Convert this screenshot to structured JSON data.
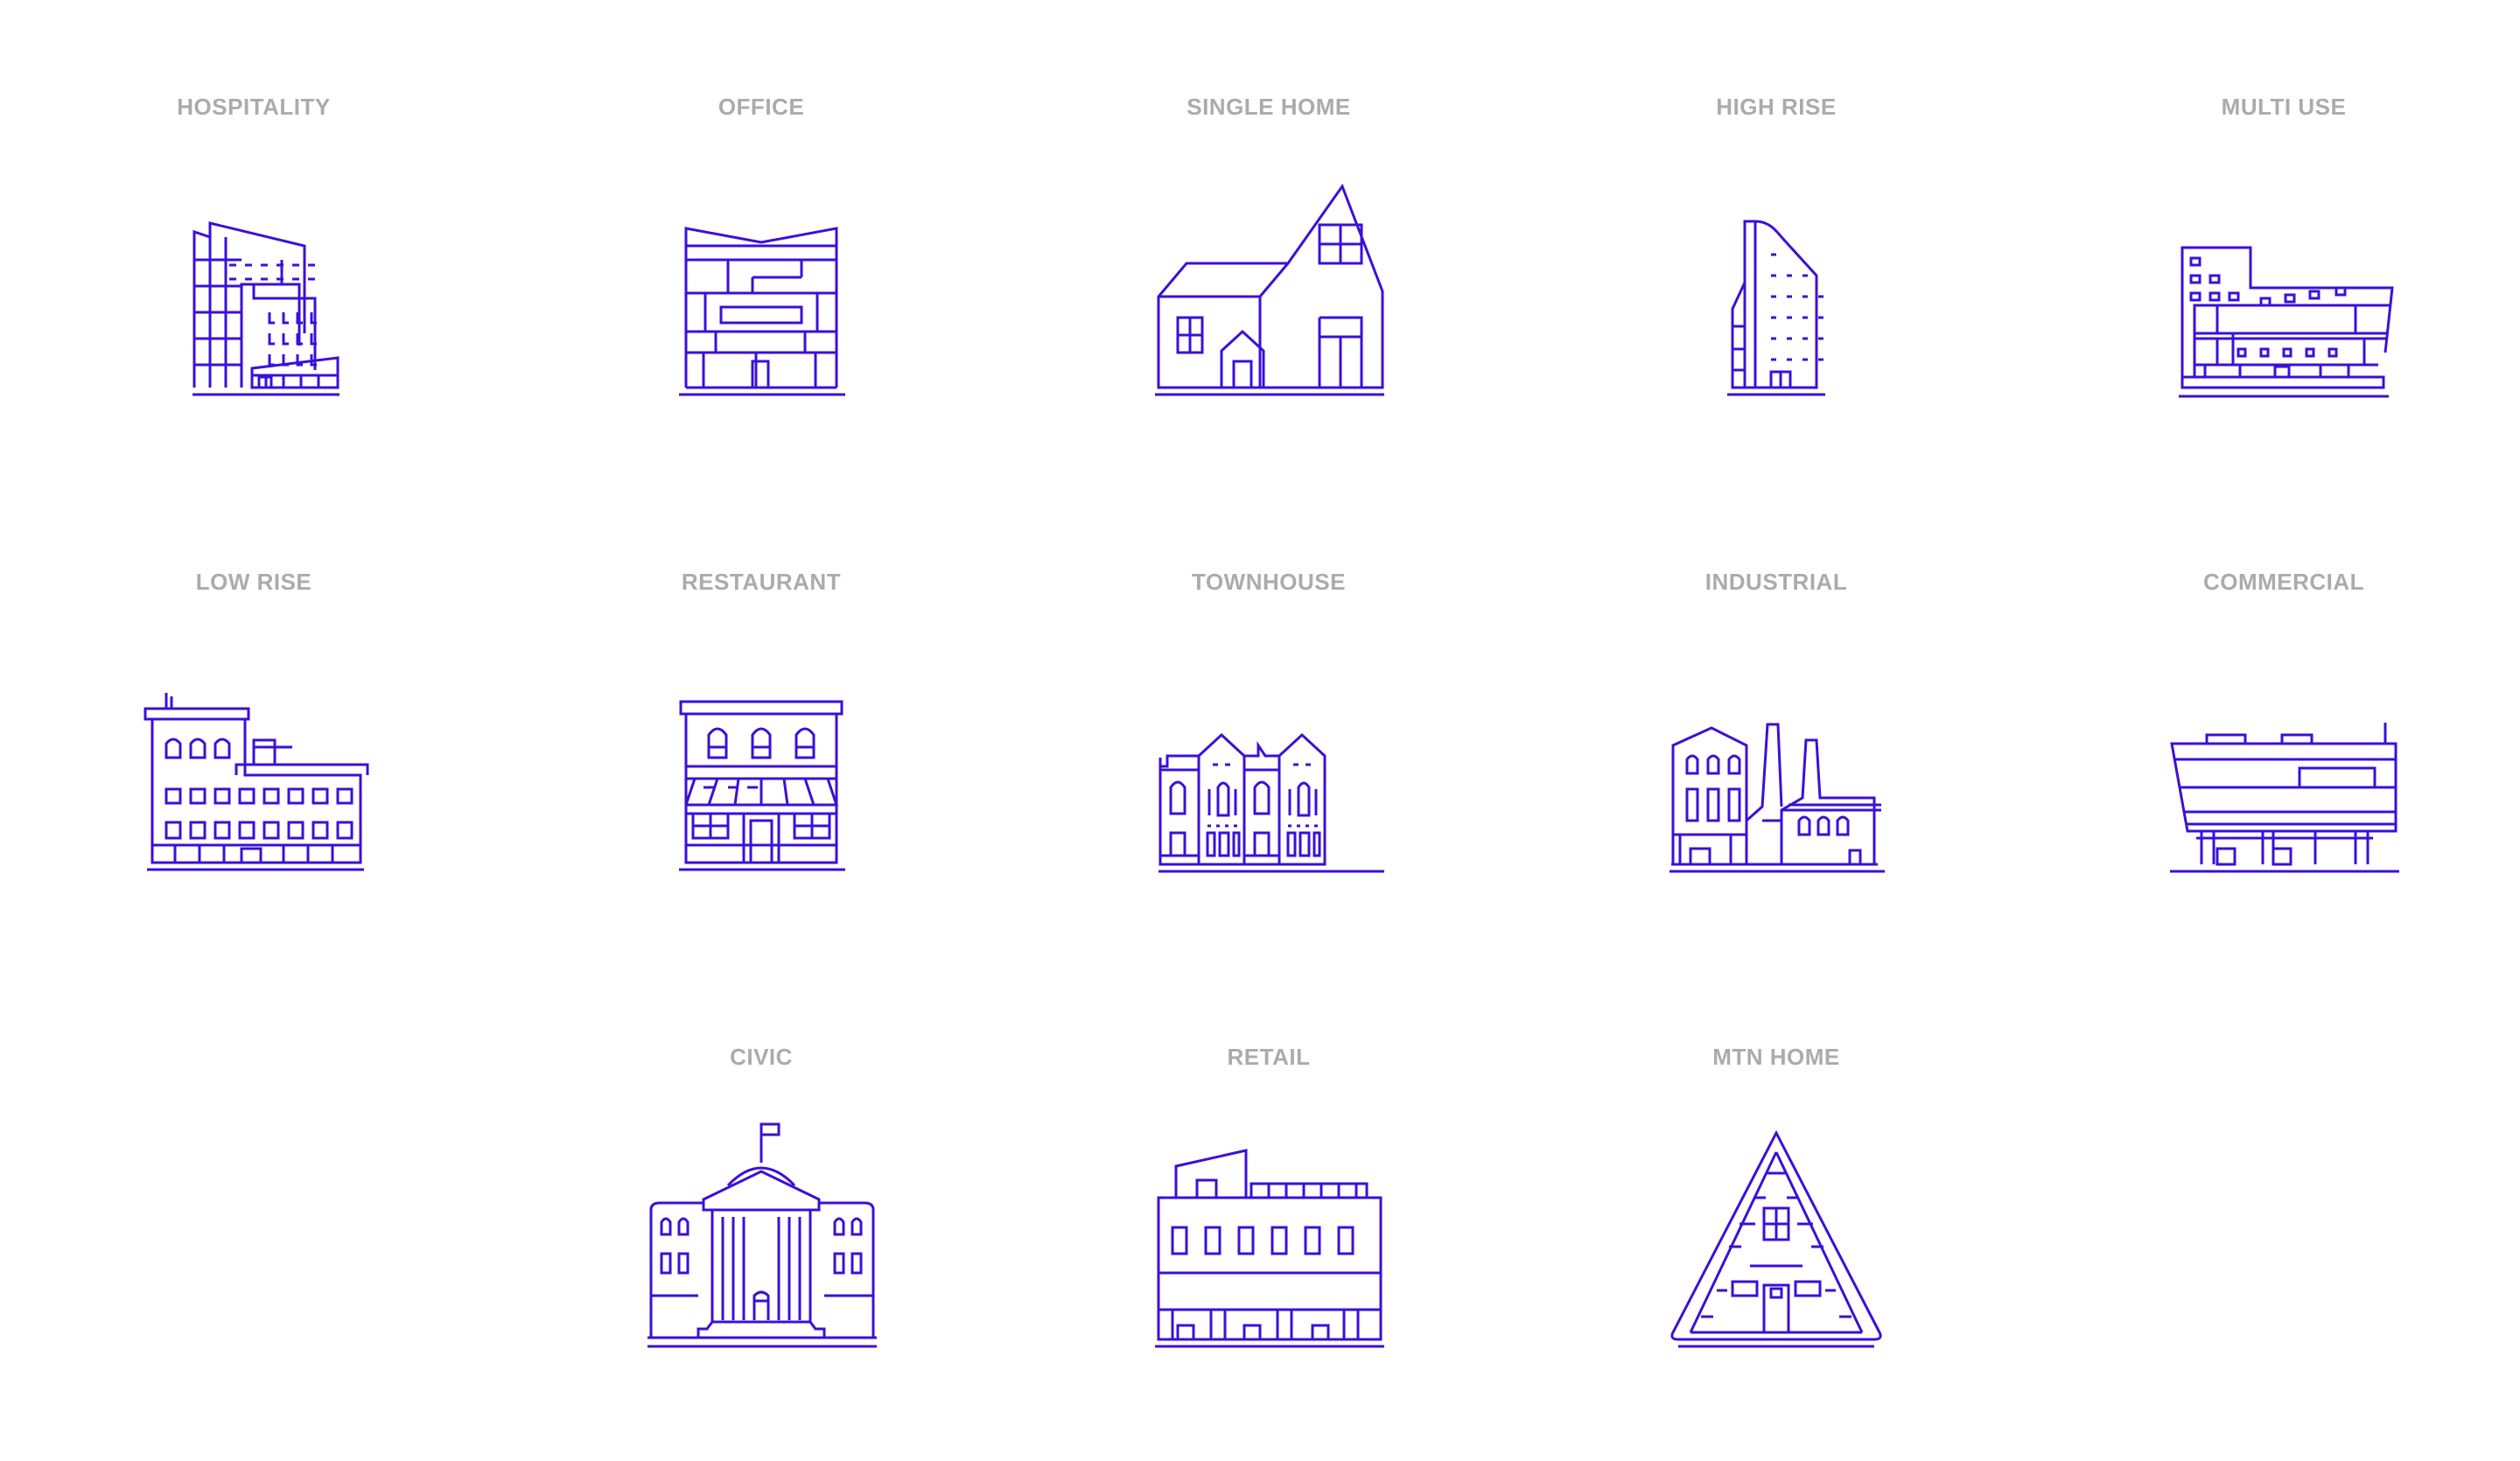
{
  "accent_color": "#3a10d8",
  "label_color": "#ababab",
  "tiles": [
    {
      "id": "hospitality",
      "label": "HOSPITALITY",
      "icon": "hospitality-building-icon"
    },
    {
      "id": "office",
      "label": "OFFICE",
      "icon": "office-building-icon"
    },
    {
      "id": "single-home",
      "label": "SINGLE HOME",
      "icon": "single-home-icon"
    },
    {
      "id": "high-rise",
      "label": "HIGH RISE",
      "icon": "high-rise-icon"
    },
    {
      "id": "multi-use",
      "label": "MULTI USE",
      "icon": "multi-use-building-icon"
    },
    {
      "id": "low-rise",
      "label": "LOW RISE",
      "icon": "low-rise-building-icon"
    },
    {
      "id": "restaurant",
      "label": "RESTAURANT",
      "icon": "restaurant-icon"
    },
    {
      "id": "townhouse",
      "label": "TOWNHOUSE",
      "icon": "townhouse-icon"
    },
    {
      "id": "industrial",
      "label": "INDUSTRIAL",
      "icon": "industrial-factory-icon"
    },
    {
      "id": "commercial",
      "label": "COMMERCIAL",
      "icon": "commercial-building-icon"
    },
    {
      "id": "civic",
      "label": "CIVIC",
      "icon": "civic-building-icon"
    },
    {
      "id": "retail",
      "label": "RETAIL",
      "icon": "retail-store-icon"
    },
    {
      "id": "mtn-home",
      "label": "MTN HOME",
      "icon": "mountain-home-icon"
    }
  ]
}
